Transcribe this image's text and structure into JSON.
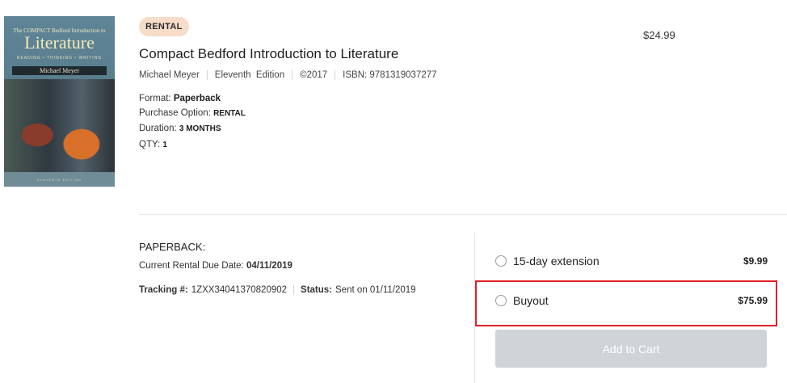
{
  "item": {
    "badge": "RENTAL",
    "title": "Compact Bedford Introduction to Literature",
    "author": "Michael Meyer",
    "edition": "Eleventh  Edition",
    "year": "©2017",
    "isbn": "ISBN: 9781319037277",
    "format_label": "Format:",
    "format_value": "Paperback",
    "purchase_label": "Purchase Option:",
    "purchase_value": "RENTAL",
    "duration_label": "Duration:",
    "duration_value": "3 MONTHS",
    "qty_label": "QTY:",
    "qty_value": "1",
    "price": "$24.99"
  },
  "cover": {
    "top_line": "The COMPACT Bedford Introduction to",
    "title": "Literature",
    "subtitle": "READING • THINKING • WRITING",
    "author": "Michael Meyer",
    "edition": "ELEVENTH EDITION"
  },
  "rental": {
    "type_label": "PAPERBACK:",
    "due_label": "Current Rental Due Date:",
    "due_value": "04/11/2019",
    "tracking_label": "Tracking #:",
    "tracking_value": "1ZXX34041370820902",
    "status_label": "Status:",
    "status_value": "Sent on 01/11/2019"
  },
  "options": [
    {
      "label": "15-day extension",
      "price": "$9.99"
    },
    {
      "label": "Buyout",
      "price": "$75.99"
    }
  ],
  "add_to_cart": "Add to Cart",
  "colors": {
    "badge_bg": "#f6dcc9",
    "highlight_border": "#e0202a",
    "button_disabled_bg": "#cfd4d8"
  }
}
